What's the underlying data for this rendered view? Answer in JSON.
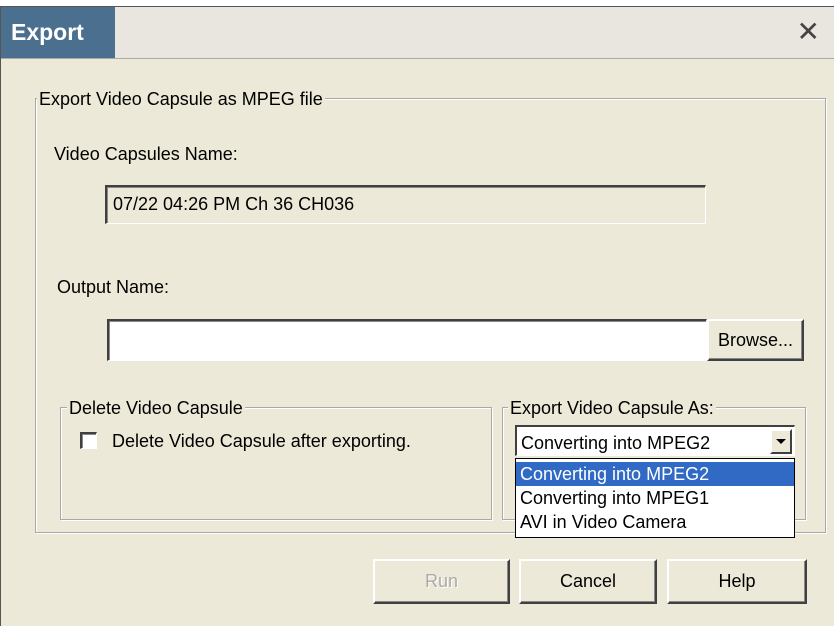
{
  "window": {
    "title": "Export",
    "close_glyph": "✕"
  },
  "group_export": {
    "legend": "Export Video Capsule as MPEG file",
    "capsule_name_label": "Video Capsules Name:",
    "capsule_name_value": "07/22 04:26 PM Ch 36 CH036",
    "output_name_label": "Output Name:",
    "output_name_value": "",
    "browse_label": "Browse..."
  },
  "group_delete": {
    "legend": "Delete Video Capsule",
    "checkbox_label": "Delete Video Capsule after exporting.",
    "checked": false
  },
  "group_format": {
    "legend": "Export Video Capsule As:",
    "selected": "Converting into MPEG2",
    "options": [
      {
        "label": "Converting into MPEG2",
        "highlighted": true
      },
      {
        "label": "Converting into MPEG1",
        "highlighted": false
      },
      {
        "label": "AVI in Video Camera",
        "highlighted": false
      }
    ]
  },
  "buttons": {
    "run": "Run",
    "cancel": "Cancel",
    "help": "Help"
  },
  "colors": {
    "dialog_bg": "#ECE9D8",
    "title_tab_bg": "#4B6F8F",
    "selection_bg": "#316AC5"
  }
}
